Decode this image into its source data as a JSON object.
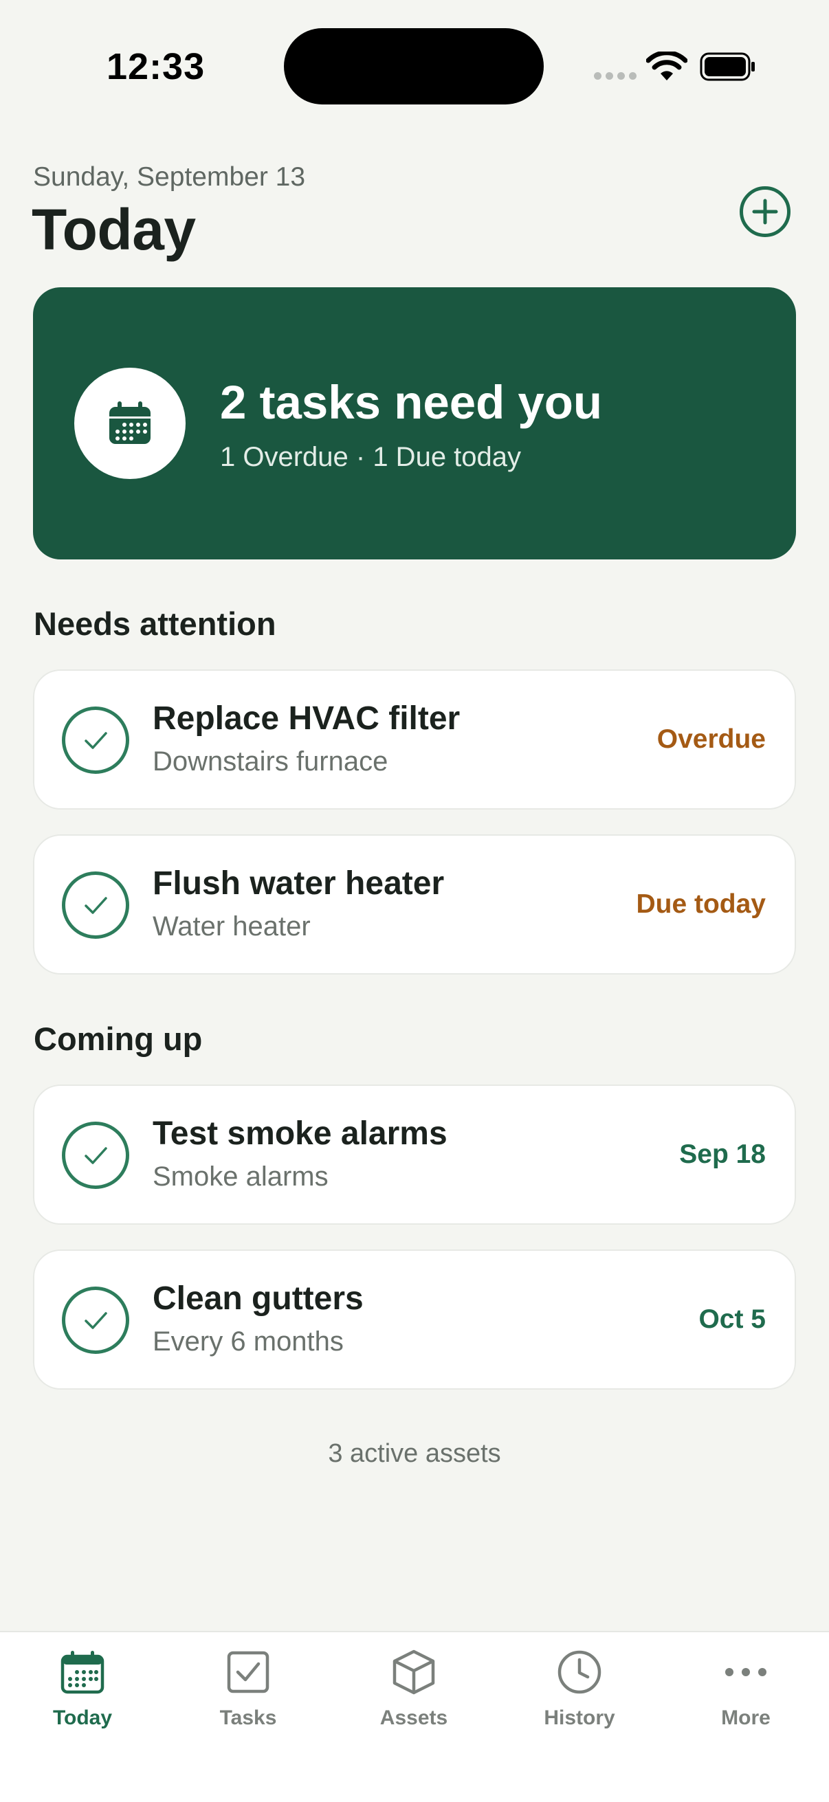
{
  "status_bar": {
    "time": "12:33"
  },
  "header": {
    "date": "Sunday, September 13",
    "title": "Today"
  },
  "summary": {
    "title": "2 tasks need you",
    "subtitle": "1 Overdue · 1 Due today"
  },
  "sections": {
    "needs_attention": "Needs attention",
    "coming_up": "Coming up"
  },
  "tasks": [
    {
      "title": "Replace HVAC filter",
      "subtitle": "Downstairs furnace",
      "status": "Overdue",
      "status_color": "#a45a14"
    },
    {
      "title": "Flush water heater",
      "subtitle": "Water heater",
      "status": "Due today",
      "status_color": "#a45a14"
    },
    {
      "title": "Test smoke alarms",
      "subtitle": "Smoke alarms",
      "status": "Sep 18",
      "status_color": "#1f6b4d"
    },
    {
      "title": "Clean gutters",
      "subtitle": "Every 6 months",
      "status": "Oct 5",
      "status_color": "#1f6b4d"
    }
  ],
  "footer_note": "3 active assets",
  "tabs": [
    {
      "label": "Today",
      "icon": "calendar-icon",
      "active": true
    },
    {
      "label": "Tasks",
      "icon": "checkbox-icon",
      "active": false
    },
    {
      "label": "Assets",
      "icon": "box-icon",
      "active": false
    },
    {
      "label": "History",
      "icon": "clock-icon",
      "active": false
    },
    {
      "label": "More",
      "icon": "more-dots-icon",
      "active": false
    }
  ],
  "colors": {
    "brand": "#1a5740",
    "accent": "#1f6b4d",
    "warning": "#a45a14",
    "background": "#f4f5f1"
  }
}
